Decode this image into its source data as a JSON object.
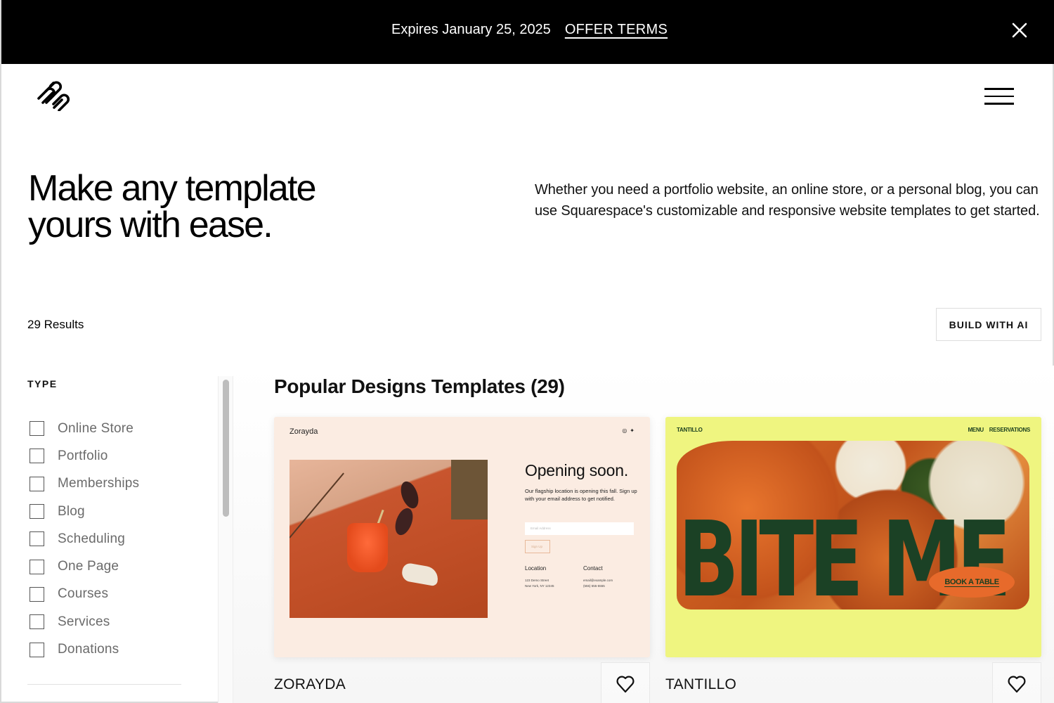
{
  "banner": {
    "expires_text": "Expires January 25, 2025",
    "offer_link": "OFFER TERMS",
    "close_icon": "close-icon"
  },
  "header": {
    "logo": "squarespace-logo",
    "menu_icon": "hamburger-menu-icon"
  },
  "hero": {
    "title_line1": "Make any template",
    "title_line2": "yours with ease.",
    "description": "Whether you need a portfolio website, an online store, or a personal blog, you can use Squarespace's customizable and responsive website templates to get started."
  },
  "results": {
    "count_label": "29 Results",
    "build_ai_button": "BUILD WITH AI"
  },
  "filters": {
    "type_heading": "TYPE",
    "items": [
      {
        "label": "Online Store",
        "checked": false
      },
      {
        "label": "Portfolio",
        "checked": false
      },
      {
        "label": "Memberships",
        "checked": false
      },
      {
        "label": "Blog",
        "checked": false
      },
      {
        "label": "Scheduling",
        "checked": false
      },
      {
        "label": "One Page",
        "checked": false
      },
      {
        "label": "Courses",
        "checked": false
      },
      {
        "label": "Services",
        "checked": false
      },
      {
        "label": "Donations",
        "checked": false
      }
    ]
  },
  "section": {
    "title": "Popular Designs Templates (29)"
  },
  "templates": [
    {
      "name": "ZORAYDA",
      "preview": {
        "brand": "Zorayda",
        "social": [
          "instagram-icon",
          "twitter-icon"
        ],
        "heading": "Opening soon.",
        "body": "Our flagship location is opening this fall. Sign up with your email address to get notified.",
        "email_placeholder": "Email Address",
        "signup_button": "Sign Up",
        "location_heading": "Location",
        "location_line1": "123 Demo Street",
        "location_line2": "New York, NY 12345",
        "contact_heading": "Contact",
        "contact_line1": "email@example.com",
        "contact_line2": "(555) 555-5555"
      },
      "bg_color": "#fbece2"
    },
    {
      "name": "TANTILLO",
      "preview": {
        "brand": "TANTILLO",
        "nav": [
          "MENU",
          "RESERVATIONS"
        ],
        "headline": "BITE ME",
        "cta": "BOOK A TABLE"
      },
      "bg_color": "#eff580",
      "accent_color": "#1b4125",
      "cta_color": "#e76a2b"
    }
  ]
}
